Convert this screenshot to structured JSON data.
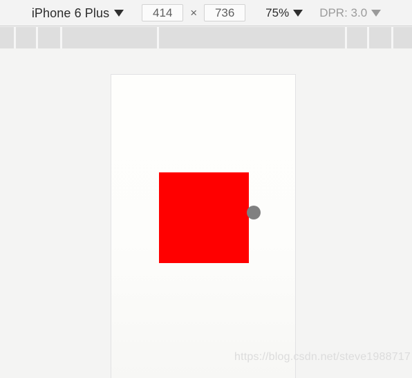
{
  "toolbar": {
    "device_name": "iPhone 6 Plus",
    "device_caret_icon": "chevron-down-icon",
    "width_value": "414",
    "width_placeholder": "414",
    "height_value": "736",
    "height_placeholder": "736",
    "dimension_separator": "×",
    "zoom_label": "75%",
    "zoom_caret_icon": "chevron-down-icon",
    "dpr_label": "DPR: 3.0",
    "dpr_caret_icon": "chevron-down-icon"
  },
  "ruler": {
    "tick_positions": [
      20,
      52,
      87,
      227,
      499,
      531,
      566
    ],
    "background_color": "#dedede",
    "tick_color": "#f6f6f6"
  },
  "viewport": {
    "background_color": "#fdfdfb",
    "border_color": "#e2e2e4",
    "content": {
      "red_box": {
        "name": "red-square",
        "color": "#ff0000",
        "width": "130",
        "height": "131"
      },
      "resize_handle": {
        "name": "resize-handle",
        "color": "#808080"
      }
    }
  },
  "watermark": {
    "text": "https://blog.csdn.net/steve1988717",
    "color": "#dcdcdc"
  },
  "canvas": {
    "background_color": "#f4f4f3"
  }
}
